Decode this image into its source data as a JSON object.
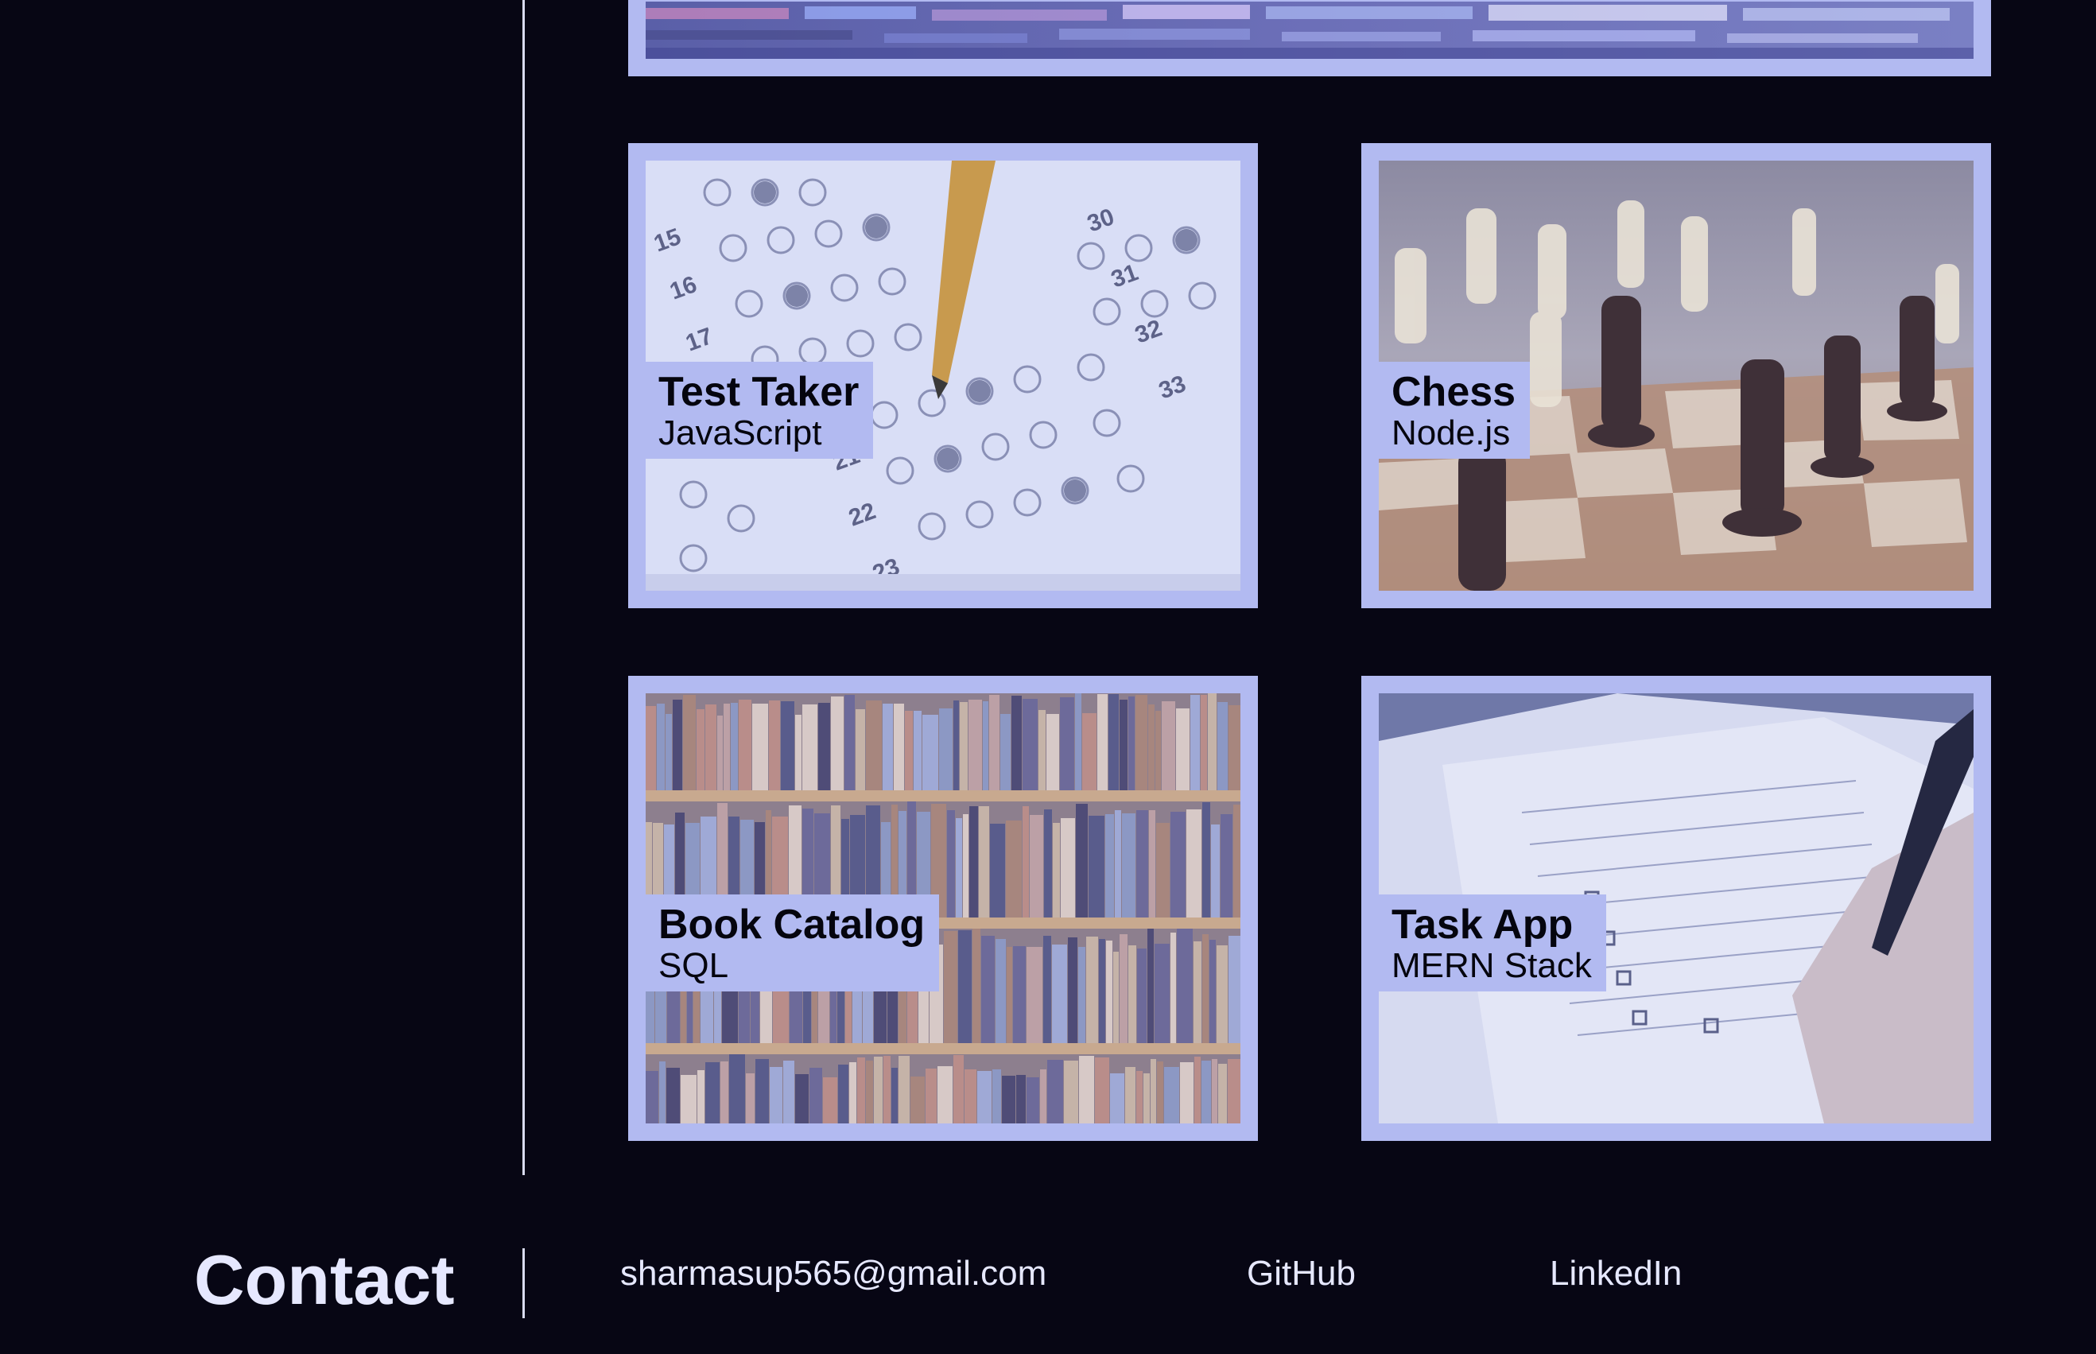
{
  "projects": [
    {
      "title": "Test Taker",
      "tech": "JavaScript"
    },
    {
      "title": "Chess",
      "tech": "Node.js"
    },
    {
      "title": "Book Catalog",
      "tech": "SQL"
    },
    {
      "title": "Task App",
      "tech": "MERN Stack"
    }
  ],
  "contact": {
    "heading": "Contact",
    "email": "sharmasup565@gmail.com",
    "github": "GitHub",
    "linkedin": "LinkedIn"
  },
  "colors": {
    "background": "#070614",
    "card_frame": "#b2baf1",
    "text_light": "#e6e8ff",
    "text_dark": "#05050e"
  }
}
